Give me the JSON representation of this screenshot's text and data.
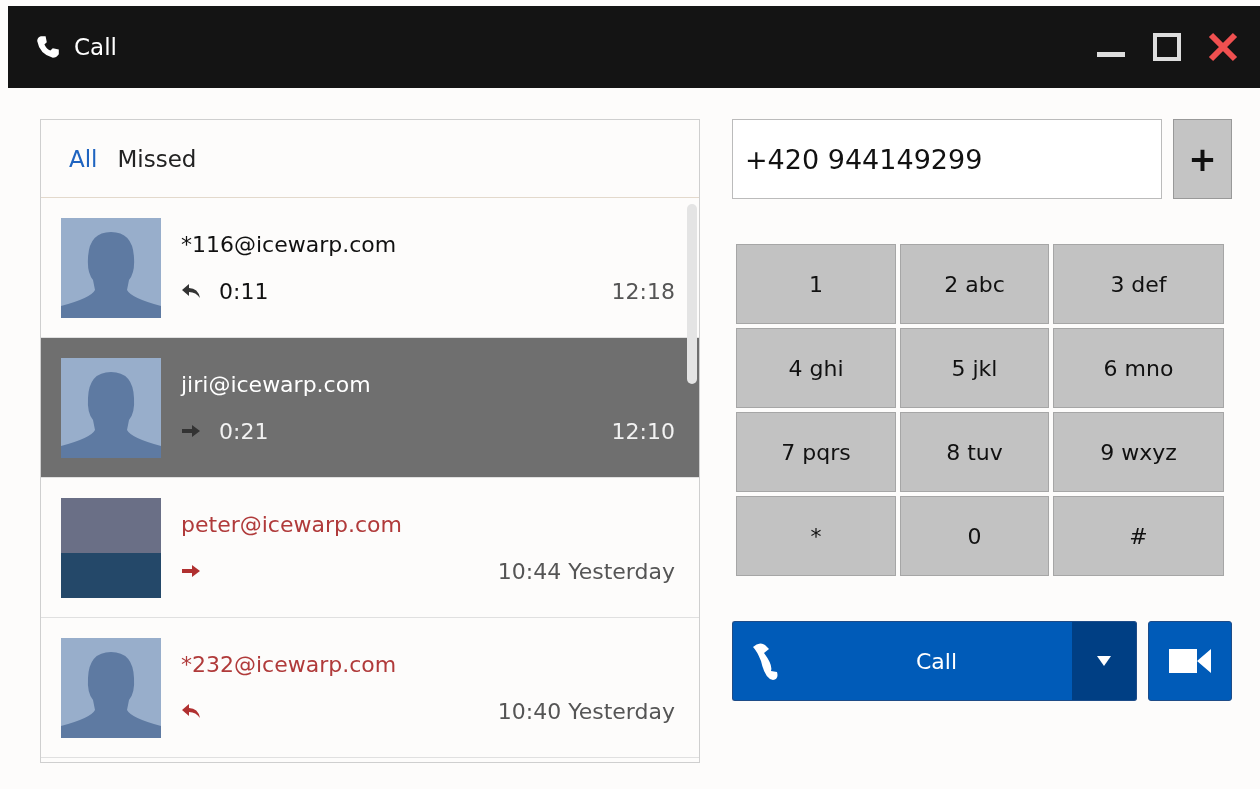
{
  "window": {
    "title": "Call"
  },
  "filter_tabs": [
    {
      "label": "All",
      "selected": true
    },
    {
      "label": "Missed",
      "selected": false
    }
  ],
  "calls": [
    {
      "address": "*116@icewarp.com",
      "avatar": {
        "kind": "silhouette"
      },
      "direction_icon": {
        "kind": "in"
      },
      "missed": false,
      "duration": "0:11",
      "time": "12:18",
      "selected": false
    },
    {
      "address": "jiri@icewarp.com",
      "avatar": {
        "kind": "silhouette"
      },
      "direction_icon": {
        "kind": "out"
      },
      "missed": false,
      "duration": "0:21",
      "time": "12:10",
      "selected": true
    },
    {
      "address": "peter@icewarp.com",
      "avatar": {
        "kind": "photo"
      },
      "direction_icon": {
        "kind": "out"
      },
      "missed": true,
      "time": "10:44 Yesterday",
      "selected": false
    },
    {
      "address": "*232@icewarp.com",
      "avatar": {
        "kind": "silhouette"
      },
      "direction_icon": {
        "kind": "in"
      },
      "missed": true,
      "time": "10:40 Yesterday",
      "selected": false
    }
  ],
  "number_field": {
    "value": "+420 944149299"
  },
  "add_button": {
    "label": "+"
  },
  "keypad": [
    "1",
    "2 abc",
    "3 def",
    "4 ghi",
    "5 jkl",
    "6 mno",
    "7 pqrs",
    "8 tuv",
    "9 wxyz",
    "*",
    "0",
    "#"
  ],
  "call_button": {
    "label": "Call"
  }
}
